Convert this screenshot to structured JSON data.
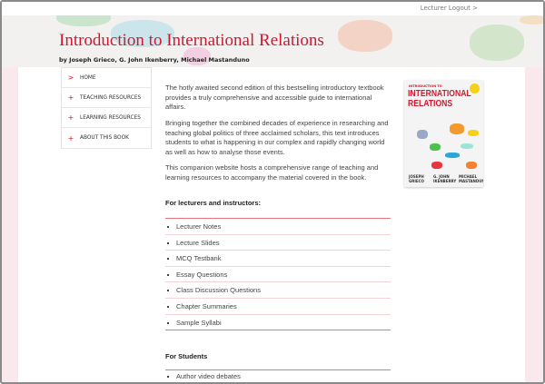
{
  "topbar": {
    "logout_label": "Lecturer Logout >"
  },
  "header": {
    "title": "Introduction to International Relations",
    "authors": "by Joseph Grieco, G. John Ikenberry, Michael Mastanduno"
  },
  "nav": {
    "items": [
      {
        "label": "HOME",
        "icon": "chevron-right-icon",
        "glyph": ">"
      },
      {
        "label": "TEACHING RESOURCES",
        "icon": "plus-icon",
        "glyph": "+"
      },
      {
        "label": "LEARNING RESOURCES",
        "icon": "plus-icon",
        "glyph": "+"
      },
      {
        "label": "ABOUT THIS BOOK",
        "icon": "plus-icon",
        "glyph": "+"
      }
    ]
  },
  "main": {
    "paragraphs": [
      "The hotly awaited second edition of this bestselling introductory textbook provides a truly comprehensive and accessible guide to international affairs.",
      "Bringing together the combined decades of experience in researching and teaching global politics of three acclaimed scholars, this text introduces students to what is happening in our complex and rapidly changing world as well as how to analyse those events.",
      "This companion website hosts a comprehensive range of teaching and learning resources to accompany the material covered in the book."
    ],
    "lecturers_heading": "For lecturers and instructors:",
    "lecturer_items": [
      "Lecturer Notes",
      "Lecture Slides",
      "MCQ Testbank",
      "Essay Questions",
      "Class Discussion Questions",
      "Chapter Summaries",
      "Sample Syllabi"
    ],
    "students_heading": "For Students",
    "student_items": [
      "Author video debates"
    ]
  },
  "cover": {
    "kicker": "INTRODUCTION TO",
    "title_line1": "INTERNATIONAL",
    "title_line2": "RELATIONS",
    "authors": [
      "JOSEPH\nGRIECO",
      "G. JOHN\nIKENBERRY",
      "MICHAEL\nMASTANDUNO"
    ]
  },
  "colors": {
    "accent": "#d0182f",
    "page_bg": "#f9e9ec"
  }
}
